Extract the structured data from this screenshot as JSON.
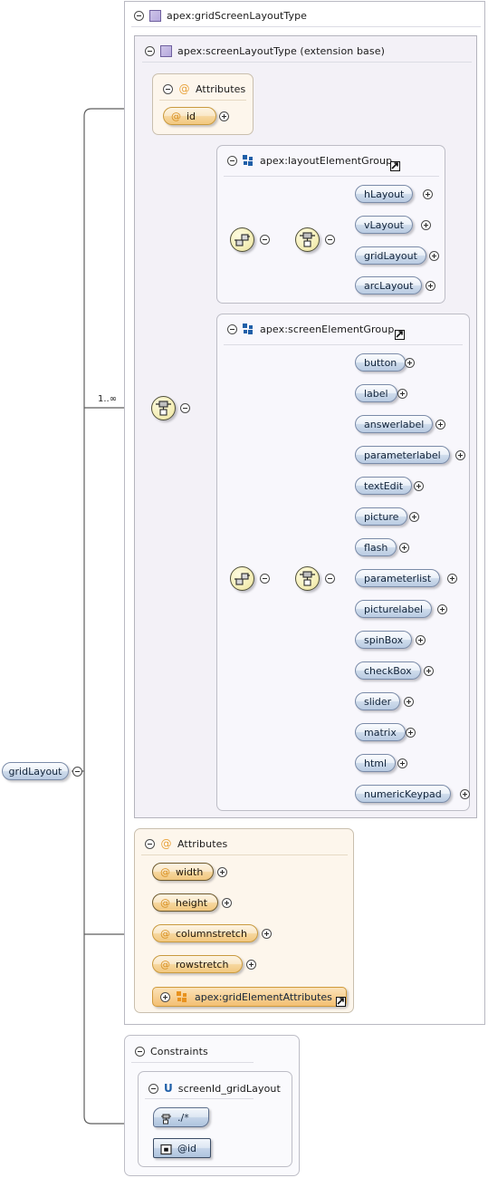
{
  "diagram": {
    "kind": "xml-schema-element-diagram",
    "root_element": {
      "label": "gridLayout",
      "icon": "element-pill"
    },
    "occurs": "1..∞"
  },
  "outer_type": {
    "title": "apex:gridScreenLayoutType",
    "icon": "complex-type-icon",
    "expander": "minus"
  },
  "base_type": {
    "title": "apex:screenLayoutType (extension base)",
    "icon": "complex-type-icon",
    "expander": "minus"
  },
  "base_attributes": {
    "title": "Attributes",
    "icon": "attribute-icon",
    "items": [
      {
        "label": "id",
        "icon": "attribute-icon",
        "expander": "plus",
        "required": false
      }
    ]
  },
  "layout_element_group": {
    "title": "apex:layoutElementGroup",
    "icon": "model-group-icon",
    "external_link": "external-link-icon",
    "compositors": [
      {
        "name": "choice",
        "icon": "choice-icon"
      },
      {
        "name": "sequence",
        "icon": "sequence-icon"
      }
    ],
    "items": [
      {
        "label": "hLayout",
        "expander": "plus"
      },
      {
        "label": "vLayout",
        "expander": "plus"
      },
      {
        "label": "gridLayout",
        "expander": "plus"
      },
      {
        "label": "arcLayout",
        "expander": "plus"
      }
    ]
  },
  "screen_element_group": {
    "title": "apex:screenElementGroup",
    "icon": "model-group-icon",
    "external_link": "external-link-icon",
    "compositors": [
      {
        "name": "choice",
        "icon": "choice-icon"
      },
      {
        "name": "sequence",
        "icon": "sequence-icon"
      }
    ],
    "items": [
      {
        "label": "button",
        "expander": "plus"
      },
      {
        "label": "label",
        "expander": "plus"
      },
      {
        "label": "answerlabel",
        "expander": "plus"
      },
      {
        "label": "parameterlabel",
        "expander": "plus"
      },
      {
        "label": "textEdit",
        "expander": "plus"
      },
      {
        "label": "picture",
        "expander": "plus"
      },
      {
        "label": "flash",
        "expander": "plus"
      },
      {
        "label": "parameterlist",
        "expander": "plus"
      },
      {
        "label": "picturelabel",
        "expander": "plus"
      },
      {
        "label": "spinBox",
        "expander": "plus"
      },
      {
        "label": "checkBox",
        "expander": "plus"
      },
      {
        "label": "slider",
        "expander": "plus"
      },
      {
        "label": "matrix",
        "expander": "plus"
      },
      {
        "label": "html",
        "expander": "plus"
      },
      {
        "label": "numericKeypad",
        "expander": "plus"
      }
    ]
  },
  "grid_attributes": {
    "title": "Attributes",
    "icon": "attribute-icon",
    "items": [
      {
        "label": "width",
        "icon": "attribute-icon",
        "expander": "plus",
        "required": true
      },
      {
        "label": "height",
        "icon": "attribute-icon",
        "expander": "plus",
        "required": true
      },
      {
        "label": "columnstretch",
        "icon": "attribute-icon",
        "expander": "plus",
        "required": false
      },
      {
        "label": "rowstretch",
        "icon": "attribute-icon",
        "expander": "plus",
        "required": false
      }
    ],
    "group_ref": {
      "label": "apex:gridElementAttributes",
      "icon": "model-group-icon-orange",
      "expander": "plus",
      "external_link": "external-link-icon"
    }
  },
  "constraints": {
    "title": "Constraints",
    "unique": {
      "title": "screenId_gridLayout",
      "icon": "unique-icon",
      "selector": {
        "label": "./*",
        "icon": "selector-icon"
      },
      "field": {
        "label": "@id",
        "icon": "field-icon"
      }
    }
  },
  "colors": {
    "element_pill_border": "#7a8ba8",
    "attribute_pill_border": "#c99a3e",
    "compositor_fill": "#f6f0bc",
    "type_icon": "#b6a9dd",
    "group_icon": "#1f5fa8",
    "group_icon_orange": "#e8921f",
    "container_bg": "#f3f1f7",
    "attrs_bg": "#fdf6ec"
  }
}
